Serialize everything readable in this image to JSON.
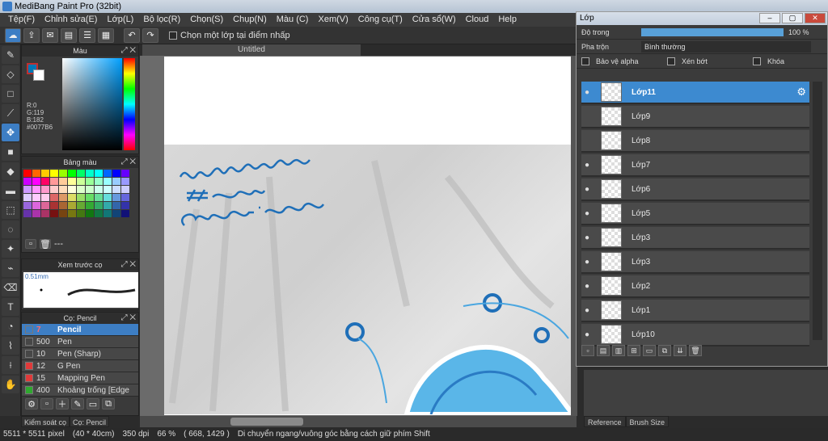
{
  "window": {
    "title": "MediBang Paint Pro (32bit)"
  },
  "menu": [
    "Tệp(F)",
    "Chỉnh sửa(E)",
    "Lớp(L)",
    "Bộ lọc(R)",
    "Chọn(S)",
    "Chụp(N)",
    "Màu (C)",
    "Xem(V)",
    "Công cụ(T)",
    "Cửa sổ(W)",
    "Cloud",
    "Help"
  ],
  "toolbar": {
    "select_layer_label": "Chọn một lớp tại điểm nhấp"
  },
  "color_panel": {
    "title": "Màu",
    "r": "R:0",
    "g": "G:119",
    "b": "B:182",
    "hex": "#0077B6",
    "fg_color": "#0077b6"
  },
  "palette_panel": {
    "title": "Bảng màu",
    "name": "---"
  },
  "preview_panel": {
    "title": "Xem trước cọ",
    "size": "0.51mm"
  },
  "brush_panel": {
    "title": "Cọ: Pencil",
    "brushes": [
      {
        "size": "7",
        "name": "Pencil",
        "color": "#3d7ec4"
      },
      {
        "size": "500",
        "name": "Pen",
        "color": ""
      },
      {
        "size": "10",
        "name": "Pen (Sharp)",
        "color": ""
      },
      {
        "size": "12",
        "name": "G Pen",
        "color": "#e03a3a"
      },
      {
        "size": "15",
        "name": "Mapping Pen",
        "color": "#e03a3a"
      },
      {
        "size": "400",
        "name": "Khoảng trống [Edge",
        "color": "#2fa82f"
      }
    ]
  },
  "left_tabs": [
    "Kiểm soát cọ",
    "Cọ: Pencil"
  ],
  "document": {
    "tab_title": "Untitled"
  },
  "layers_window": {
    "title": "Lớp",
    "opacity_label": "Độ trong",
    "opacity_value": "100 %",
    "opacity": 1.0,
    "blend_label": "Pha trộn",
    "blend_value": "Bình thường",
    "protect_alpha": "Bảo vệ alpha",
    "clip": "Xén bớt",
    "lock": "Khóa",
    "layers": [
      {
        "name": "Lớp11",
        "visible": true,
        "selected": true
      },
      {
        "name": "Lớp9",
        "visible": false,
        "selected": false
      },
      {
        "name": "Lớp8",
        "visible": false,
        "selected": false
      },
      {
        "name": "Lớp7",
        "visible": true,
        "selected": false
      },
      {
        "name": "Lớp6",
        "visible": true,
        "selected": false
      },
      {
        "name": "Lớp5",
        "visible": true,
        "selected": false
      },
      {
        "name": "Lớp3",
        "visible": true,
        "selected": false
      },
      {
        "name": "Lớp3",
        "visible": true,
        "selected": false
      },
      {
        "name": "Lớp2",
        "visible": true,
        "selected": false
      },
      {
        "name": "Lớp1",
        "visible": true,
        "selected": false
      },
      {
        "name": "Lớp10",
        "visible": true,
        "selected": false
      }
    ]
  },
  "right_tabs": [
    "Reference",
    "Brush Size"
  ],
  "status": {
    "size": "5511 * 5511 pixel",
    "cm": "(40 * 40cm)",
    "dpi": "350 dpi",
    "zoom": "66 %",
    "coords": "( 668, 1429 )",
    "hint": "Di chuyển ngang/vuông góc bằng cách giữ phím Shift"
  }
}
